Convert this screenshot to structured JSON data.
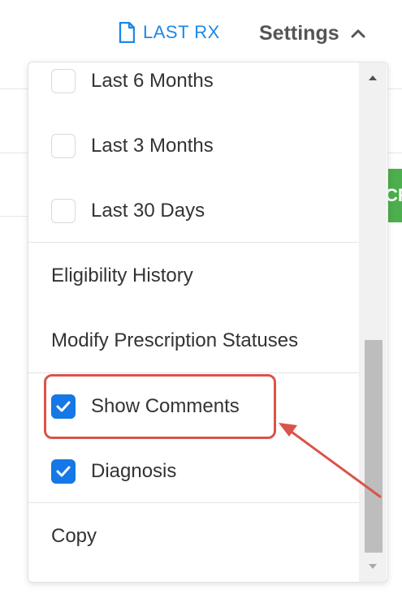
{
  "topbar": {
    "last_rx_label": "LAST RX",
    "settings_label": "Settings",
    "accent_color": "#1e88e5"
  },
  "background": {
    "partial_button_text": "CR"
  },
  "menu": {
    "date_filters": [
      {
        "label": "Last 6 Months",
        "checked": false
      },
      {
        "label": "Last 3 Months",
        "checked": false
      },
      {
        "label": "Last 30 Days",
        "checked": false
      }
    ],
    "actions": [
      {
        "label": "Eligibility History"
      },
      {
        "label": "Modify Prescription Statuses"
      }
    ],
    "toggles": [
      {
        "label": "Show Comments",
        "checked": true
      },
      {
        "label": "Diagnosis",
        "checked": true
      }
    ],
    "footer": [
      {
        "label": "Copy"
      }
    ]
  },
  "colors": {
    "checkbox_checked": "#1677e6",
    "annotation_red": "#d9544a"
  },
  "icons": {
    "last_rx": "document-icon",
    "settings": "chevron-up-icon",
    "checkmark": "checkmark-icon"
  }
}
